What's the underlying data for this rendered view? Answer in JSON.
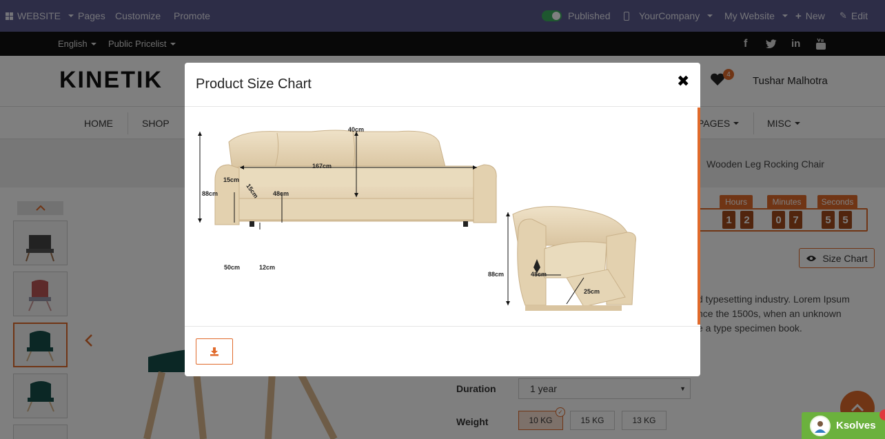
{
  "topbar": {
    "website": "WEBSITE",
    "pages": "Pages",
    "customize": "Customize",
    "promote": "Promote",
    "published": "Published",
    "company": "YourCompany",
    "my_website": "My Website",
    "new": "New",
    "edit": "Edit"
  },
  "subbar": {
    "language": "English",
    "pricelist": "Public Pricelist"
  },
  "header": {
    "logo": "KINETIK",
    "wishlist_count": "4",
    "user": "Tushar Malhotra"
  },
  "nav": {
    "items": [
      "HOME",
      "SHOP",
      "PAGES",
      "MISC"
    ]
  },
  "breadcrumb": {
    "current": "Wooden Leg Rocking Chair"
  },
  "countdown": {
    "labels": [
      "Hours",
      "Minutes",
      "Seconds"
    ],
    "hours": [
      "1",
      "2"
    ],
    "minutes": [
      "0",
      "7"
    ],
    "seconds": [
      "5",
      "5"
    ]
  },
  "product": {
    "size_chart_button": "Size Chart",
    "description_lines": [
      "d typesetting industry. Lorem Ipsum",
      "nce the 1500s, when an unknown",
      "e a type specimen book."
    ],
    "duration_label": "Duration",
    "duration_value": "1 year",
    "weight_label": "Weight",
    "weights": [
      "10 KG",
      "15 KG",
      "13 KG"
    ]
  },
  "modal": {
    "title": "Product Size Chart",
    "dimensions": {
      "sofa_top_depth": "40cm",
      "sofa_width": "167cm",
      "sofa_height": "88cm",
      "arm_width": "15cm",
      "arm_height": "15cm",
      "seat_depth": "48cm",
      "seat_height": "50cm",
      "leg_height": "12cm",
      "chair_height": "88cm",
      "chair_seat": "48cm",
      "footrest": "25cm"
    }
  },
  "chat": {
    "label": "Ksolves"
  },
  "colors": {
    "topbar": "#5b5a8f",
    "accent": "#e06a2b",
    "toggle": "#3dae5f",
    "chat": "#6bb13d"
  }
}
